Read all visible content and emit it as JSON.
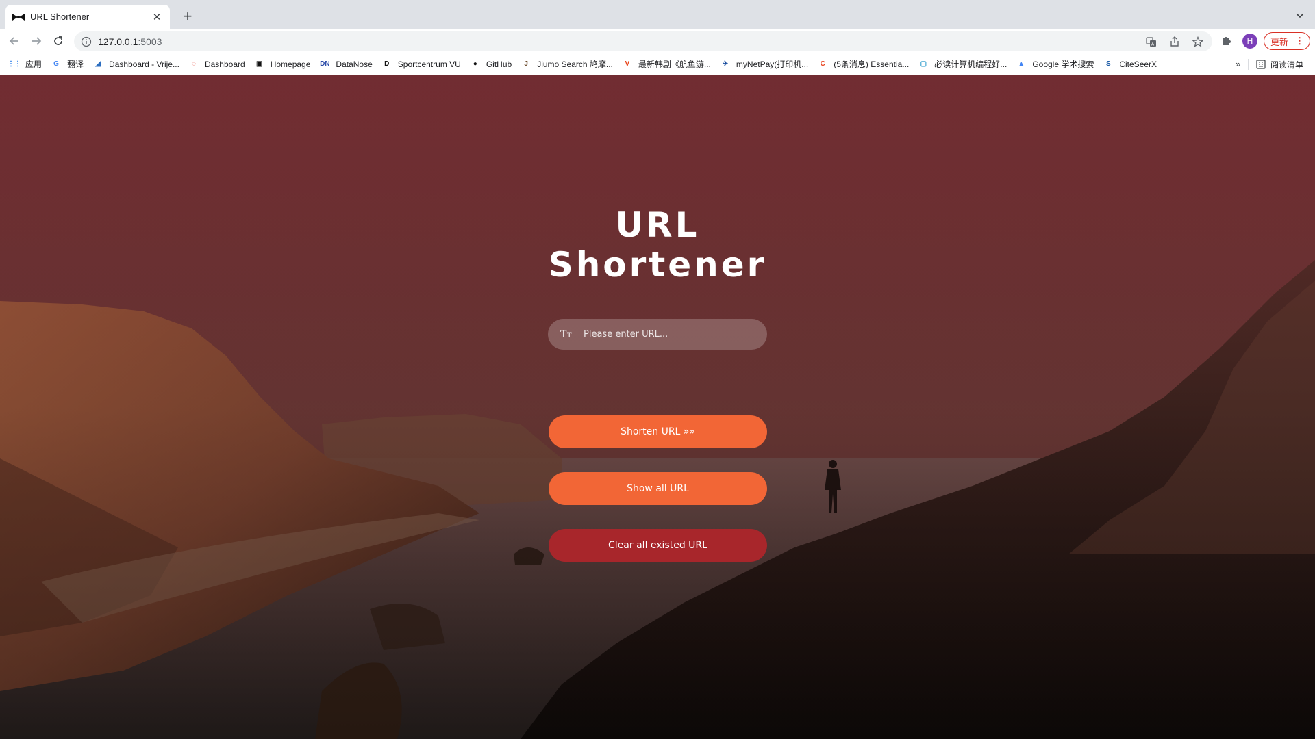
{
  "tab": {
    "title": "URL Shortener"
  },
  "address_bar": {
    "host": "127.0.0.1",
    "port": ":5003"
  },
  "toolbar": {
    "profile_initial": "H",
    "update_label": "更新"
  },
  "bookmarks": [
    {
      "label": "应用",
      "icon": "apps-grid-icon",
      "color": "#1a73e8"
    },
    {
      "label": "翻译",
      "icon": "translate-icon",
      "color": "#4285f4"
    },
    {
      "label": "Dashboard - Vrije...",
      "icon": "canvas-icon",
      "color": "#2c6ec0"
    },
    {
      "label": "Dashboard",
      "icon": "circle-dashed-icon",
      "color": "#e34234"
    },
    {
      "label": "Homepage",
      "icon": "homepage-icon",
      "color": "#111111"
    },
    {
      "label": "DataNose",
      "icon": "datanose-icon",
      "color": "#2a4aa8"
    },
    {
      "label": "Sportcentrum VU",
      "icon": "sport-icon",
      "color": "#111111"
    },
    {
      "label": "GitHub",
      "icon": "github-icon",
      "color": "#111111"
    },
    {
      "label": "Jiumo Search 鸠摩...",
      "icon": "jiumo-icon",
      "color": "#6b4b2b"
    },
    {
      "label": "最新韩剧《航鱼游...",
      "icon": "v-icon",
      "color": "#e8471c"
    },
    {
      "label": "myNetPay(打印机...",
      "icon": "bird-icon",
      "color": "#1b4fa0"
    },
    {
      "label": "(5条消息) Essentia...",
      "icon": "csdn-icon",
      "color": "#e8421e"
    },
    {
      "label": "必读计算机编程好...",
      "icon": "bilibili-icon",
      "color": "#2196c9"
    },
    {
      "label": "Google 学术搜索",
      "icon": "scholar-icon",
      "color": "#4285f4"
    },
    {
      "label": "CiteSeerX",
      "icon": "citeseer-icon",
      "color": "#1a5aa6"
    }
  ],
  "bookmarks_more": "»",
  "reading_list_label": "阅读清单",
  "main": {
    "title_line1": "URL",
    "title_line2": "Shortener",
    "url_placeholder": "Please enter URL...",
    "input_icon": "Tт",
    "shorten_button": "Shorten URL »»",
    "show_all_button": "Show all URL",
    "clear_button": "Clear all existed URL"
  },
  "colors": {
    "primary_button": "#f26636",
    "danger_button": "#a8262b"
  }
}
